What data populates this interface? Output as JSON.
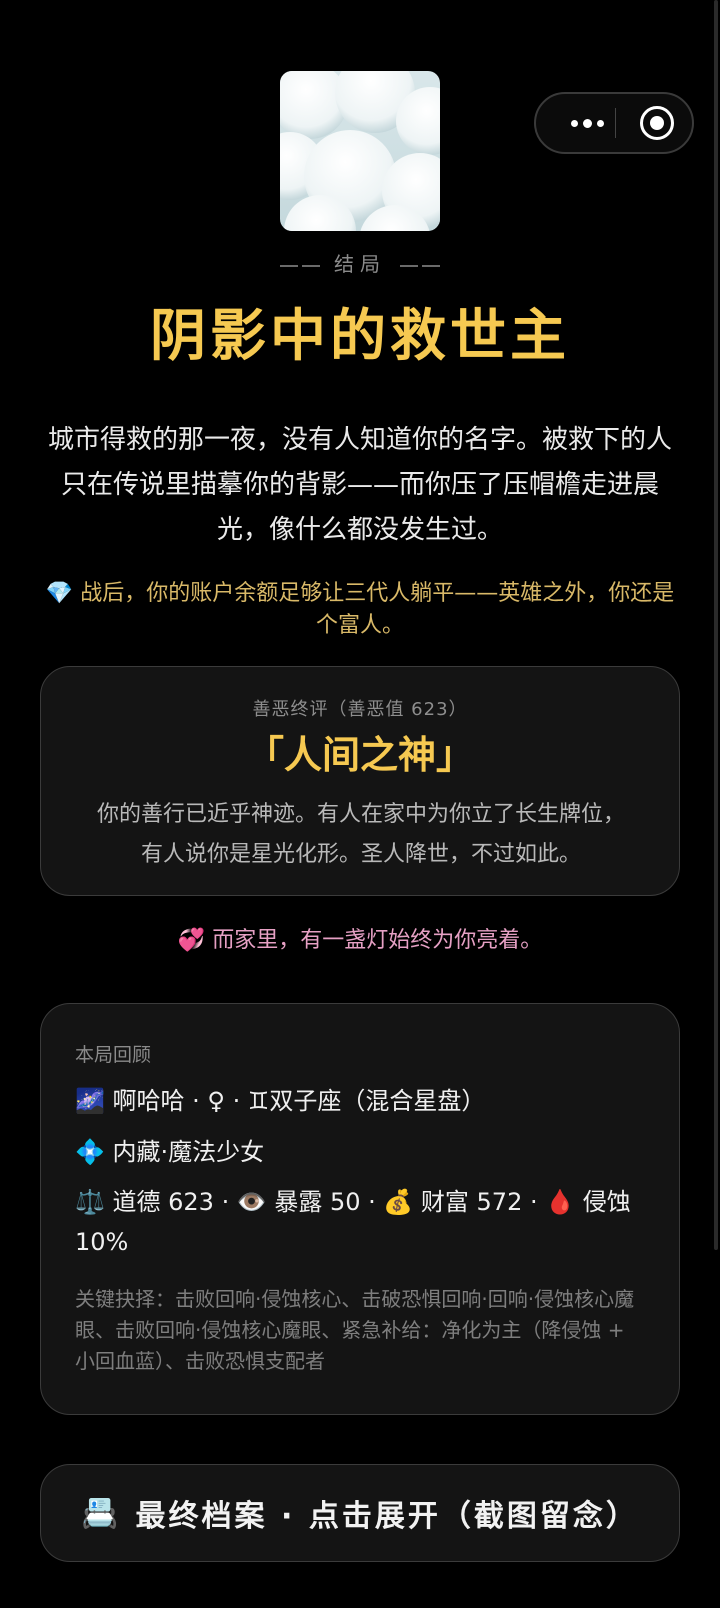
{
  "nav": {
    "more_icon": "more-dots-icon",
    "close_icon": "target-circle-icon"
  },
  "cover": {
    "icon": "clouds-image"
  },
  "ending": {
    "label": "结局",
    "title": "阴影中的救世主",
    "story": "城市得救的那一夜，没有人知道你的名字。被救下的人只在传说里描摹你的背影——而你压了压帽檐走进晨光，像什么都没发生过。",
    "wealth_emoji": "💎",
    "wealth_text": "战后，你的账户余额足够让三代人躺平——英雄之外，你还是个富人。"
  },
  "verdict": {
    "caption": "善恶终评（善恶值 623）",
    "title": "「人间之神」",
    "description": "你的善行已近乎神迹。有人在家中为你立了长生牌位，有人说你是星光化形。圣人降世，不过如此。"
  },
  "family": {
    "emoji": "💞",
    "text": "而家里，有一盏灯始终为你亮着。"
  },
  "recap": {
    "heading": "本局回顾",
    "profile_line": "🌌 啊哈哈 · ♀ · ♊双子座（混合星盘）",
    "type_line": "💠 内藏·魔法少女",
    "stats_line": "⚖️ 道德 623 · 👁️ 暴露 50 · 💰 财富 572 · 🩸 侵蚀 10%",
    "key_choices": "关键抉择：击败回响·侵蚀核心、击破恐惧回响·回响·侵蚀核心魔眼、击败回响·侵蚀核心魔眼、紧急补给：净化为主（降侵蚀 + 小回血蓝）、击败恐惧支配者"
  },
  "archive_button": {
    "emoji": "📇",
    "label": "最终档案 · 点击展开（截图留念）"
  },
  "colors": {
    "gold": "#f6c951",
    "wealth_gold": "#d9b968",
    "pink": "#e6a0c4",
    "card_bg": "#141414",
    "border": "#3b3b3b"
  }
}
